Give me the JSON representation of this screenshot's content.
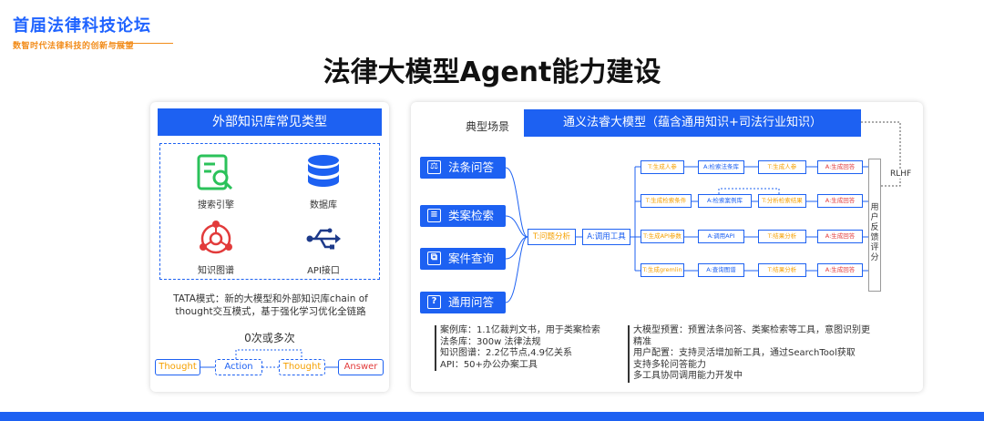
{
  "brand": {
    "title": "首届法律科技论坛",
    "subtitle": "数智时代法律科技的创新与展望"
  },
  "title": "法律大模型Agent能力建设",
  "left_panel": {
    "header": "外部知识库常见类型",
    "items": [
      {
        "label": "搜索引擎",
        "icon": "search-engine-icon",
        "color": "#2bc25a"
      },
      {
        "label": "数据库",
        "icon": "database-icon",
        "color": "#1d61f2"
      },
      {
        "label": "知识图谱",
        "icon": "knowledge-graph-icon",
        "color": "#e23b3b"
      },
      {
        "label": "API接口",
        "icon": "usb-icon",
        "color": "#1d3a8a"
      }
    ],
    "tata_text": "TATA模式：新的大模型和外部知识库chain of thought交互模式，基于强化学习优化全链路",
    "loop_label": "0次或多次",
    "flow": [
      "Thought",
      "Action",
      "Thought",
      "Answer"
    ]
  },
  "right_panel": {
    "scene_label": "典型场景",
    "model_header": "通义法睿大模型（蕴含通用知识+司法行业知识）",
    "scenes": [
      {
        "label": "法条问答",
        "icon": "gavel-icon",
        "glyph": "⚖"
      },
      {
        "label": "类案检索",
        "icon": "document-icon",
        "glyph": "≡"
      },
      {
        "label": "案件查询",
        "icon": "files-icon",
        "glyph": "⧉"
      },
      {
        "label": "通用问答",
        "icon": "question-icon",
        "glyph": "?"
      }
    ],
    "central_nodes": {
      "t": "T:问题分析",
      "a": "A:调用工具"
    },
    "rows": [
      [
        "T:生成人参",
        "A:检索法条库",
        "T:生成人参",
        "A:生成回答"
      ],
      [
        "T:生成检索条件",
        "A:检索案例库",
        "T:分析检索结果",
        "A:生成回答"
      ],
      [
        "T:生成API参数",
        "A:调用API",
        "T:结果分析",
        "A:生成回答"
      ],
      [
        "T:生成gremlin",
        "A:查询图谱",
        "T:结果分析",
        "A:生成回答"
      ]
    ],
    "feedback": [
      "用",
      "户",
      "反",
      "馈",
      "评",
      "分"
    ],
    "rlhf": "RLHF",
    "notes_left": [
      "案例库：1.1亿裁判文书，用于类案检索",
      "法条库：300w 法律法规",
      "知识图谱：2.2亿节点,4.9亿关系",
      "API：50+办公办案工具"
    ],
    "notes_right": [
      "大模型预置：预置法条问答、类案检索等工具，意图识别更精准",
      "用户配置：支持灵活增加新工具，通过SearchTool获取",
      "支持多轮问答能力",
      "多工具协同调用能力开发中"
    ]
  },
  "colors": {
    "accent": "#1d61f2",
    "thought": "#f5a000",
    "answer": "#e23b3b",
    "brand_orange": "#f28c1a"
  }
}
